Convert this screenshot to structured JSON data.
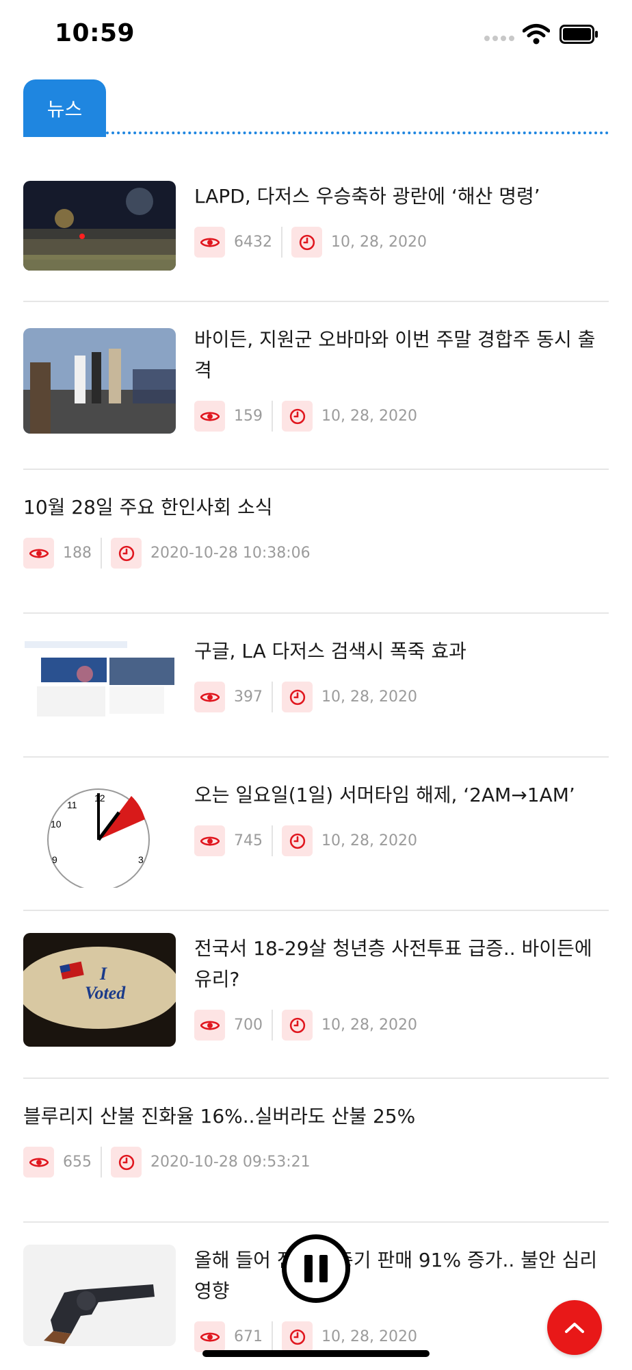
{
  "status_bar": {
    "time": "10:59"
  },
  "tabs": [
    {
      "label": "뉴스",
      "active": true
    }
  ],
  "colors": {
    "accent": "#1f86e0",
    "icon_red": "#e0161e",
    "icon_bg": "#fde4e4",
    "meta_text": "#9b9b9b",
    "fab": "#e81818"
  },
  "icons": {
    "views": "eye-icon",
    "time": "clock-icon",
    "scroll_top": "chevron-up-icon",
    "media": "pause-icon"
  },
  "news": [
    {
      "title": "LAPD, 다저스 우승축하 광란에 ‘해산 명령’",
      "views": "6432",
      "date": "10, 28, 2020",
      "thumbnail": "night street crowd photo"
    },
    {
      "title": "바이든, 지원군 오바마와 이번 주말 경합주 동시 출격",
      "views": "159",
      "date": "10, 28, 2020",
      "thumbnail": "stage rally photo"
    },
    {
      "title": "10월 28일 주요 한인사회 소식",
      "views": "188",
      "date": "2020-10-28 10:38:06"
    },
    {
      "title": "구글, LA 다저스 검색시 폭죽 효과",
      "views": "397",
      "date": "10, 28, 2020",
      "thumbnail": "search results screenshot"
    },
    {
      "title": "오는 일요일(1일) 서머타임 해제, ‘2AM→1AM’",
      "views": "745",
      "date": "10, 28, 2020",
      "thumbnail": "clock illustration"
    },
    {
      "title": "전국서 18-29살 청년층 사전투표 급증.. 바이든에 유리?",
      "views": "700",
      "date": "10, 28, 2020",
      "thumbnail": "I Voted sticker photo"
    },
    {
      "title": "블루리지 산불 진화율 16%..실버라도 산불 25%",
      "views": "655",
      "date": "2020-10-28 09:53:21"
    },
    {
      "title": "올해 들어 전국서 총기 판매 91% 증가.. 불안 심리 영향",
      "views": "671",
      "date": "10, 28, 2020",
      "thumbnail": "revolver photo"
    }
  ]
}
